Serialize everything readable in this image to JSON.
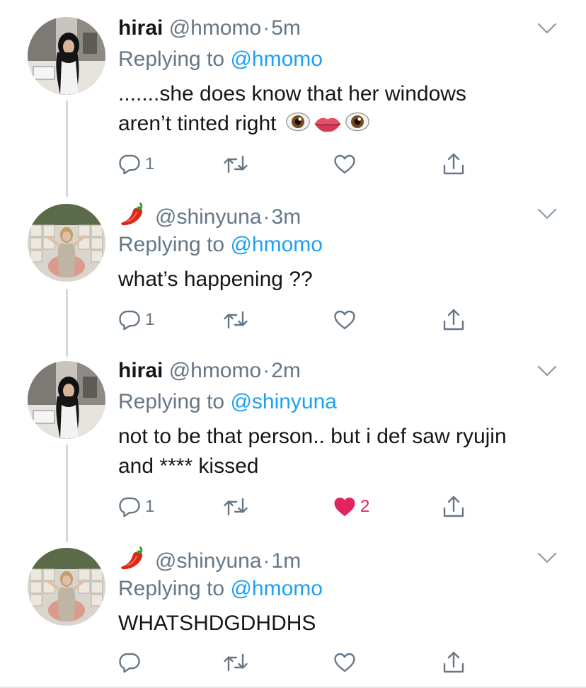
{
  "tweets": [
    {
      "display_name": "hirai",
      "handle": "@hmomo",
      "time": "5m",
      "has_chili": false,
      "replying_label": "Replying to ",
      "replying_to": "@hmomo",
      "text_line1": ".......she does know that her windows",
      "text_line2": "aren’t tinted right",
      "emoji_after": [
        "eye-icon",
        "lips-icon",
        "eye-icon"
      ],
      "reply_count": "1",
      "retweet_count": "",
      "like_count": "",
      "liked": false
    },
    {
      "display_name": "",
      "handle": "@shinyuna",
      "time": "3m",
      "has_chili": true,
      "replying_label": "Replying to ",
      "replying_to": "@hmomo",
      "text_line1": "what’s happening ??",
      "text_line2": "",
      "emoji_after": [],
      "reply_count": "1",
      "retweet_count": "",
      "like_count": "",
      "liked": false
    },
    {
      "display_name": "hirai",
      "handle": "@hmomo",
      "time": "2m",
      "has_chili": false,
      "replying_label": "Replying to ",
      "replying_to": "@shinyuna",
      "text_line1": "not to be that person.. but i def saw ryujin",
      "text_line2": "and **** kissed",
      "emoji_after": [],
      "reply_count": "1",
      "retweet_count": "",
      "like_count": "2",
      "liked": true
    },
    {
      "display_name": "",
      "handle": "@shinyuna",
      "time": "1m",
      "has_chili": true,
      "replying_label": "Replying to ",
      "replying_to": "@hmomo",
      "text_line1": "WHATSHDGDHDHS",
      "text_line2": "",
      "emoji_after": [],
      "reply_count": "",
      "retweet_count": "",
      "like_count": "",
      "liked": false
    }
  ],
  "separator": "·",
  "colors": {
    "link": "#1da1f2",
    "muted": "#657786",
    "like": "#e0245e",
    "thread_line": "#cfd9de"
  }
}
